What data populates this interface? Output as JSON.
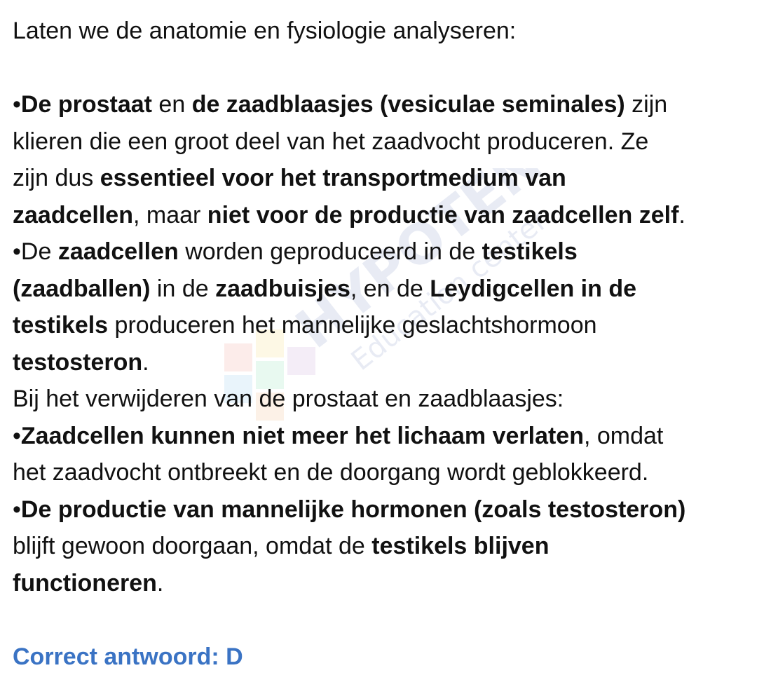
{
  "content": {
    "intro": "Laten we de anatomie en fysiologie analyseren:",
    "b1": {
      "l1_bullet": "•",
      "l1_b1": "De prostaat",
      "l1_t1": " en ",
      "l1_b2": "de zaadblaasjes (vesiculae seminales)",
      "l1_t2": " zijn",
      "l2": "klieren die een groot deel van het zaadvocht produceren. Ze",
      "l3_t1": "zijn dus ",
      "l3_b1": "essentieel voor het transportmedium van",
      "l4_b1": "zaadcellen",
      "l4_t1": ", maar ",
      "l4_b2": "niet voor de productie van zaadcellen zelf",
      "l4_t2": "."
    },
    "b2": {
      "l1_t1": "•De ",
      "l1_b1": "zaadcellen",
      "l1_t2": " worden geproduceerd in de ",
      "l1_b2": "testikels",
      "l2_b1": "(zaadballen)",
      "l2_t1": " in de ",
      "l2_b2": "zaadbuisjes",
      "l2_t2": ", en de ",
      "l2_b3": "Leydigcellen in de",
      "l3_b1": "testikels",
      "l3_t1": " produceren het mannelijke geslachtshormoon",
      "l4_b1": "testosteron",
      "l4_t1": "."
    },
    "removal_intro": "Bij het verwijderen van de prostaat en zaadblaasjes:",
    "b3": {
      "l1_bullet": "•",
      "l1_b1": "Zaadcellen kunnen niet meer het lichaam verlaten",
      "l1_t1": ", omdat",
      "l2": "het zaadvocht ontbreekt en de doorgang wordt geblokkeerd."
    },
    "b4": {
      "l1_bullet": "•",
      "l1_b1": "De productie van mannelijke hormonen (zoals testosteron)",
      "l2_t1": "blijft gewoon doorgaan, omdat de ",
      "l2_b1": "testikels blijven",
      "l3_b1": "functioneren",
      "l3_t1": "."
    },
    "answer": "Correct antwoord: D"
  },
  "watermark": {
    "brand": "HYPOTENUSE",
    "tagline": "Education center"
  },
  "colors": {
    "text": "#111111",
    "answer": "#3a73c4"
  }
}
